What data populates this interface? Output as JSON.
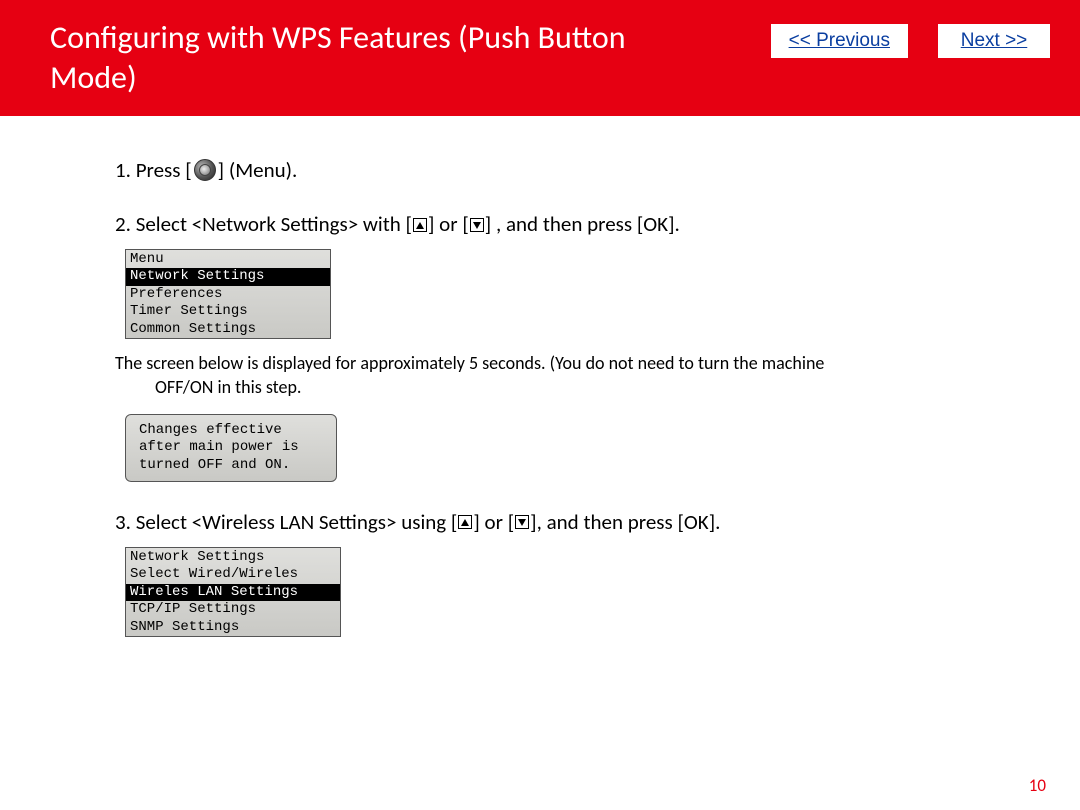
{
  "header": {
    "title": "Configuring with WPS Features (Push Button Mode)",
    "prev_label": "<< Previous",
    "next_label": "Next >>"
  },
  "steps": {
    "s1_prefix": "1. Press [",
    "s1_suffix": "] (Menu).",
    "s2_a": "2. Select <Network Settings> with [",
    "s2_b": "] or [",
    "s2_c": "] , and then press [OK].",
    "s3_a": "3. Select <Wireless LAN Settings> using [",
    "s3_b": "] or [",
    "s3_c": "], and then press [OK]."
  },
  "lcd1": {
    "title": "Menu",
    "rows": [
      "Network Settings",
      "Preferences",
      "Timer Settings",
      "Common Settings"
    ],
    "selected_index": 0
  },
  "note": {
    "line1": "The screen below is displayed for approximately 5 seconds. (You do not need to turn the machine",
    "line2": "OFF/ON in this step."
  },
  "lcd2": {
    "rows": [
      "Changes effective",
      "after main power is",
      "turned OFF and ON."
    ]
  },
  "lcd3": {
    "title": "Network Settings",
    "rows": [
      "Select Wired/Wireles",
      "Wireles LAN Settings",
      "TCP/IP Settings",
      "SNMP Settings"
    ],
    "selected_index": 1
  },
  "page_number": "10"
}
